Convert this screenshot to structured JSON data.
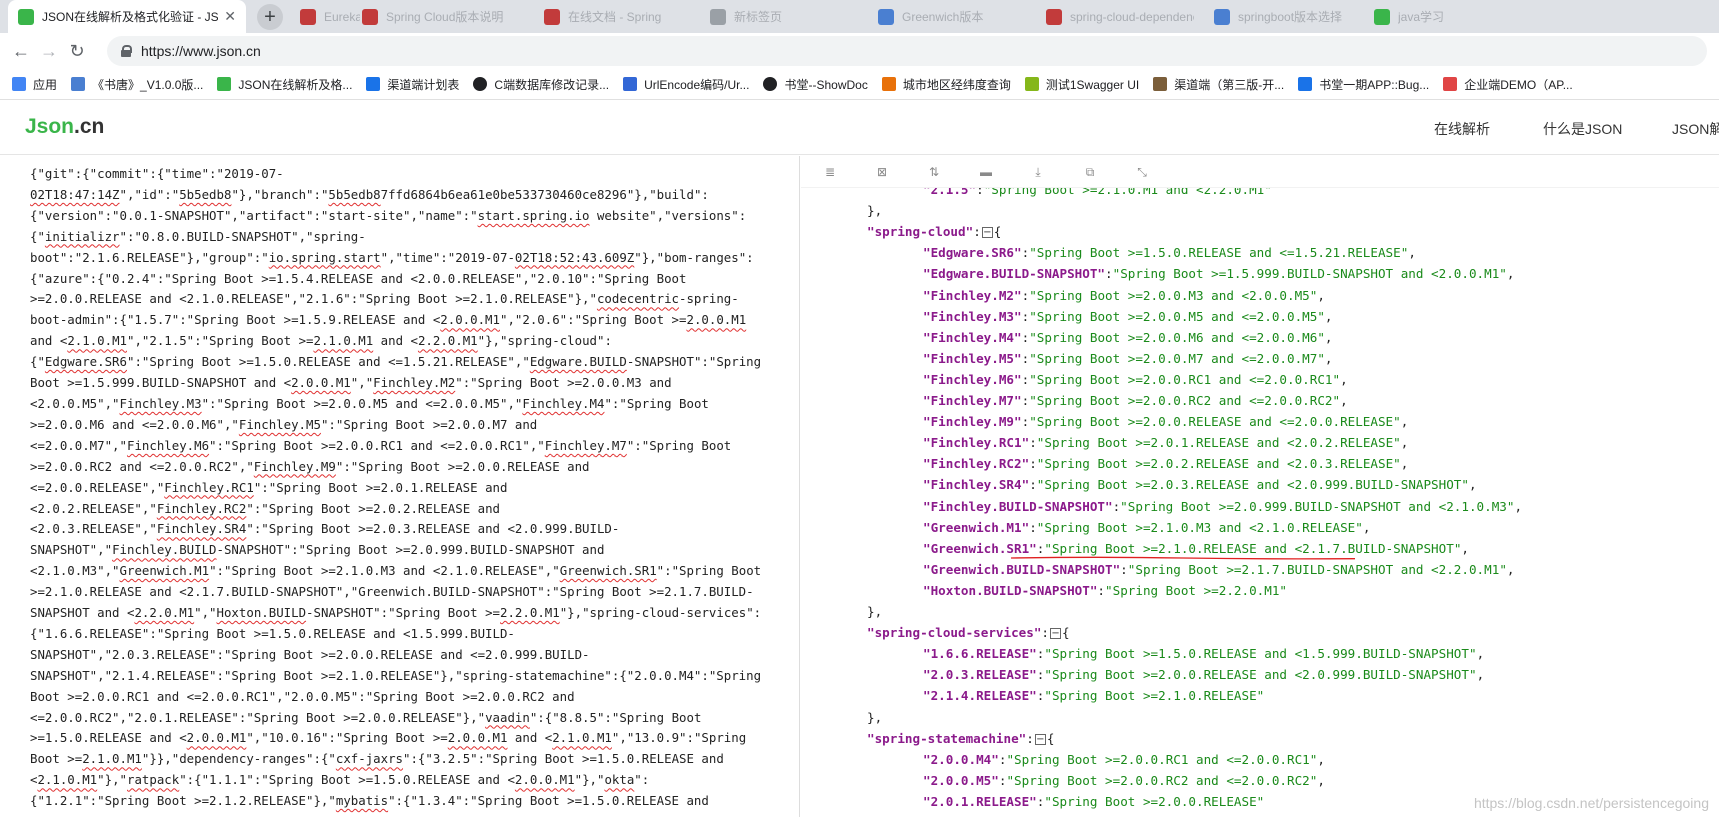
{
  "browser": {
    "tabs": [
      {
        "title": "JSON在线解析及格式化验证 - JS",
        "active": true,
        "favicon_color": "#3ab54a"
      },
      {
        "title": "Eureka注册中心原理",
        "active": false,
        "favicon_color": "#c23b3b"
      },
      {
        "title": "Spring Cloud版本说明",
        "active": false,
        "favicon_color": "#c23b3b"
      },
      {
        "title": "在线文档 - Spring",
        "active": false,
        "favicon_color": "#c23b3b"
      },
      {
        "title": "新标签页",
        "active": false,
        "favicon_color": "#9aa0a6"
      },
      {
        "title": "Greenwich版本",
        "active": false,
        "favicon_color": "#4a7fd1"
      },
      {
        "title": "spring-cloud-dependencies",
        "active": false,
        "favicon_color": "#c23b3b"
      },
      {
        "title": "springboot版本选择",
        "active": false,
        "favicon_color": "#4a7fd1"
      },
      {
        "title": "java学习",
        "active": false,
        "favicon_color": "#3ab54a"
      }
    ],
    "url": "https://www.json.cn",
    "bookmarks": [
      {
        "label": "应用",
        "icon": "apps-icon",
        "color": "#4285f4"
      },
      {
        "label": "《书唐》_V1.0.0版...",
        "icon": "doc-icon",
        "color": "#4a7fd1"
      },
      {
        "label": "JSON在线解析及格...",
        "icon": "json-icon",
        "color": "#3ab54a"
      },
      {
        "label": "渠道端计划表",
        "icon": "star-icon",
        "color": "#1a73e8"
      },
      {
        "label": "C端数据库修改记录...",
        "icon": "circle-icon",
        "color": "#202124"
      },
      {
        "label": "UrlEncode编码/Ur...",
        "icon": "tool-icon",
        "color": "#3367d6"
      },
      {
        "label": "书堂--ShowDoc",
        "icon": "circle-icon",
        "color": "#202124"
      },
      {
        "label": "城市地区经纬度查询",
        "icon": "map-icon",
        "color": "#e8710a"
      },
      {
        "label": "测试1Swagger UI",
        "icon": "swagger-icon",
        "color": "#85b71a"
      },
      {
        "label": "渠道端（第三版-开...",
        "icon": "image-icon",
        "color": "#7b5e3a"
      },
      {
        "label": "书堂一期APP::Bug...",
        "icon": "bug-icon",
        "color": "#1a73e8"
      },
      {
        "label": "企业端DEMO（AP...",
        "icon": "demo-icon",
        "color": "#e04545"
      }
    ]
  },
  "site": {
    "logo_main": "Json",
    "logo_dot": ".cn",
    "nav": [
      "在线解析",
      "什么是JSON",
      "JSON解"
    ]
  },
  "raw_json_lines": [
    "{\"git\":{\"commit\":{\"time\":\"2019-07-",
    "02T18:47:14Z\",\"id\":\"5b5edb8\"},\"branch\":\"5b5edb87ffd6864b6ea61e0be533730460ce8296\"},\"build\":",
    "{\"version\":\"0.0.1-SNAPSHOT\",\"artifact\":\"start-site\",\"name\":\"start.spring.io website\",\"versions\":",
    "{\"initializr\":\"0.8.0.BUILD-SNAPSHOT\",\"spring-",
    "boot\":\"2.1.6.RELEASE\"},\"group\":\"io.spring.start\",\"time\":\"2019-07-02T18:52:43.609Z\"},\"bom-ranges\":",
    "{\"azure\":{\"0.2.4\":\"Spring Boot >=1.5.4.RELEASE and <2.0.0.RELEASE\",\"2.0.10\":\"Spring Boot",
    ">=2.0.0.RELEASE and <2.1.0.RELEASE\",\"2.1.6\":\"Spring Boot >=2.1.0.RELEASE\"},\"codecentric-spring-",
    "boot-admin\":{\"1.5.7\":\"Spring Boot >=1.5.9.RELEASE and <2.0.0.M1\",\"2.0.6\":\"Spring Boot >=2.0.0.M1",
    "and <2.1.0.M1\",\"2.1.5\":\"Spring Boot >=2.1.0.M1 and <2.2.0.M1\"},\"spring-cloud\":",
    "{\"Edgware.SR6\":\"Spring Boot >=1.5.0.RELEASE and <=1.5.21.RELEASE\",\"Edgware.BUILD-SNAPSHOT\":\"Spring",
    "Boot >=1.5.999.BUILD-SNAPSHOT and <2.0.0.M1\",\"Finchley.M2\":\"Spring Boot >=2.0.0.M3 and",
    "<2.0.0.M5\",\"Finchley.M3\":\"Spring Boot >=2.0.0.M5 and <=2.0.0.M5\",\"Finchley.M4\":\"Spring Boot",
    ">=2.0.0.M6 and <=2.0.0.M6\",\"Finchley.M5\":\"Spring Boot >=2.0.0.M7 and",
    "<=2.0.0.M7\",\"Finchley.M6\":\"Spring Boot >=2.0.0.RC1 and <=2.0.0.RC1\",\"Finchley.M7\":\"Spring Boot",
    ">=2.0.0.RC2 and <=2.0.0.RC2\",\"Finchley.M9\":\"Spring Boot >=2.0.0.RELEASE and",
    "<=2.0.0.RELEASE\",\"Finchley.RC1\":\"Spring Boot >=2.0.1.RELEASE and",
    "<2.0.2.RELEASE\",\"Finchley.RC2\":\"Spring Boot >=2.0.2.RELEASE and",
    "<2.0.3.RELEASE\",\"Finchley.SR4\":\"Spring Boot >=2.0.3.RELEASE and <2.0.999.BUILD-",
    "SNAPSHOT\",\"Finchley.BUILD-SNAPSHOT\":\"Spring Boot >=2.0.999.BUILD-SNAPSHOT and",
    "<2.1.0.M3\",\"Greenwich.M1\":\"Spring Boot >=2.1.0.M3 and <2.1.0.RELEASE\",\"Greenwich.SR1\":\"Spring Boot",
    ">=2.1.0.RELEASE and <2.1.7.BUILD-SNAPSHOT\",\"Greenwich.BUILD-SNAPSHOT\":\"Spring Boot >=2.1.7.BUILD-",
    "SNAPSHOT and <2.2.0.M1\",\"Hoxton.BUILD-SNAPSHOT\":\"Spring Boot >=2.2.0.M1\"},\"spring-cloud-services\":",
    "{\"1.6.6.RELEASE\":\"Spring Boot >=1.5.0.RELEASE and <1.5.999.BUILD-",
    "SNAPSHOT\",\"2.0.3.RELEASE\":\"Spring Boot >=2.0.0.RELEASE and <=2.0.999.BUILD-",
    "SNAPSHOT\",\"2.1.4.RELEASE\":\"Spring Boot >=2.1.0.RELEASE\"},\"spring-statemachine\":{\"2.0.0.M4\":\"Spring",
    "Boot >=2.0.0.RC1 and <=2.0.0.RC1\",\"2.0.0.M5\":\"Spring Boot >=2.0.0.RC2 and",
    "<=2.0.0.RC2\",\"2.0.1.RELEASE\":\"Spring Boot >=2.0.0.RELEASE\"},\"vaadin\":{\"8.8.5\":\"Spring Boot",
    ">=1.5.0.RELEASE and <2.0.0.M1\",\"10.0.16\":\"Spring Boot >=2.0.0.M1 and <2.1.0.M1\",\"13.0.9\":\"Spring",
    "Boot >=2.1.0.M1\"}},\"dependency-ranges\":{\"cxf-jaxrs\":{\"3.2.5\":\"Spring Boot >=1.5.0.RELEASE and",
    "<2.1.0.M1\"},\"ratpack\":{\"1.1.1\":\"Spring Boot >=1.5.0.RELEASE and <2.0.0.M1\"},\"okta\":",
    "{\"1.2.1\":\"Spring Boot >=2.1.2.RELEASE\"},\"mybatis\":{\"1.3.4\":\"Spring Boot >=1.5.0.RELEASE and"
  ],
  "formatted_lines": [
    {
      "indent": 2,
      "type": "pair",
      "key": "2.1.5",
      "value": "Spring Boot >=2.1.0.M1 and <2.2.0.M1",
      "comma": false
    },
    {
      "indent": 1,
      "type": "close",
      "text": "},"
    },
    {
      "indent": 1,
      "type": "open",
      "key": "spring-cloud"
    },
    {
      "indent": 2,
      "type": "pair",
      "key": "Edgware.SR6",
      "value": "Spring Boot >=1.5.0.RELEASE and <=1.5.21.RELEASE",
      "comma": true
    },
    {
      "indent": 2,
      "type": "pair",
      "key": "Edgware.BUILD-SNAPSHOT",
      "value": "Spring Boot >=1.5.999.BUILD-SNAPSHOT and <2.0.0.M1",
      "comma": true
    },
    {
      "indent": 2,
      "type": "pair",
      "key": "Finchley.M2",
      "value": "Spring Boot >=2.0.0.M3 and <2.0.0.M5",
      "comma": true
    },
    {
      "indent": 2,
      "type": "pair",
      "key": "Finchley.M3",
      "value": "Spring Boot >=2.0.0.M5 and <=2.0.0.M5",
      "comma": true
    },
    {
      "indent": 2,
      "type": "pair",
      "key": "Finchley.M4",
      "value": "Spring Boot >=2.0.0.M6 and <=2.0.0.M6",
      "comma": true
    },
    {
      "indent": 2,
      "type": "pair",
      "key": "Finchley.M5",
      "value": "Spring Boot >=2.0.0.M7 and <=2.0.0.M7",
      "comma": true
    },
    {
      "indent": 2,
      "type": "pair",
      "key": "Finchley.M6",
      "value": "Spring Boot >=2.0.0.RC1 and <=2.0.0.RC1",
      "comma": true
    },
    {
      "indent": 2,
      "type": "pair",
      "key": "Finchley.M7",
      "value": "Spring Boot >=2.0.0.RC2 and <=2.0.0.RC2",
      "comma": true
    },
    {
      "indent": 2,
      "type": "pair",
      "key": "Finchley.M9",
      "value": "Spring Boot >=2.0.0.RELEASE and <=2.0.0.RELEASE",
      "comma": true
    },
    {
      "indent": 2,
      "type": "pair",
      "key": "Finchley.RC1",
      "value": "Spring Boot >=2.0.1.RELEASE and <2.0.2.RELEASE",
      "comma": true
    },
    {
      "indent": 2,
      "type": "pair",
      "key": "Finchley.RC2",
      "value": "Spring Boot >=2.0.2.RELEASE and <2.0.3.RELEASE",
      "comma": true
    },
    {
      "indent": 2,
      "type": "pair",
      "key": "Finchley.SR4",
      "value": "Spring Boot >=2.0.3.RELEASE and <2.0.999.BUILD-SNAPSHOT",
      "comma": true
    },
    {
      "indent": 2,
      "type": "pair",
      "key": "Finchley.BUILD-SNAPSHOT",
      "value": "Spring Boot >=2.0.999.BUILD-SNAPSHOT and <2.1.0.M3",
      "comma": true
    },
    {
      "indent": 2,
      "type": "pair",
      "key": "Greenwich.M1",
      "value": "Spring Boot >=2.1.0.M3 and <2.1.0.RELEASE",
      "comma": true
    },
    {
      "indent": 2,
      "type": "pair",
      "key": "Greenwich.SR1",
      "value": "Spring Boot >=2.1.0.RELEASE and <2.1.7.BUILD-SNAPSHOT",
      "comma": true,
      "highlight": true
    },
    {
      "indent": 2,
      "type": "pair",
      "key": "Greenwich.BUILD-SNAPSHOT",
      "value": "Spring Boot >=2.1.7.BUILD-SNAPSHOT and <2.2.0.M1",
      "comma": true
    },
    {
      "indent": 2,
      "type": "pair",
      "key": "Hoxton.BUILD-SNAPSHOT",
      "value": "Spring Boot >=2.2.0.M1",
      "comma": false
    },
    {
      "indent": 1,
      "type": "close",
      "text": "},"
    },
    {
      "indent": 1,
      "type": "open",
      "key": "spring-cloud-services"
    },
    {
      "indent": 2,
      "type": "pair",
      "key": "1.6.6.RELEASE",
      "value": "Spring Boot >=1.5.0.RELEASE and <1.5.999.BUILD-SNAPSHOT",
      "comma": true
    },
    {
      "indent": 2,
      "type": "pair",
      "key": "2.0.3.RELEASE",
      "value": "Spring Boot >=2.0.0.RELEASE and <2.0.999.BUILD-SNAPSHOT",
      "comma": true
    },
    {
      "indent": 2,
      "type": "pair",
      "key": "2.1.4.RELEASE",
      "value": "Spring Boot >=2.1.0.RELEASE",
      "comma": false
    },
    {
      "indent": 1,
      "type": "close",
      "text": "},"
    },
    {
      "indent": 1,
      "type": "open",
      "key": "spring-statemachine"
    },
    {
      "indent": 2,
      "type": "pair",
      "key": "2.0.0.M4",
      "value": "Spring Boot >=2.0.0.RC1 and <=2.0.0.RC1",
      "comma": true
    },
    {
      "indent": 2,
      "type": "pair",
      "key": "2.0.0.M5",
      "value": "Spring Boot >=2.0.0.RC2 and <=2.0.0.RC2",
      "comma": true
    },
    {
      "indent": 2,
      "type": "pair",
      "key": "2.0.1.RELEASE",
      "value": "Spring Boot >=2.0.0.RELEASE",
      "comma": false
    }
  ],
  "toolbar_icons": [
    "database-icon",
    "excel-icon",
    "sort-icon",
    "trash-icon",
    "download-icon",
    "copy-icon",
    "compress-icon"
  ],
  "watermark": "https://blog.csdn.net/persistencegoing",
  "colors": {
    "key": "#8b1a8b",
    "string": "#1a8a1a",
    "annotation": "#e02020"
  }
}
